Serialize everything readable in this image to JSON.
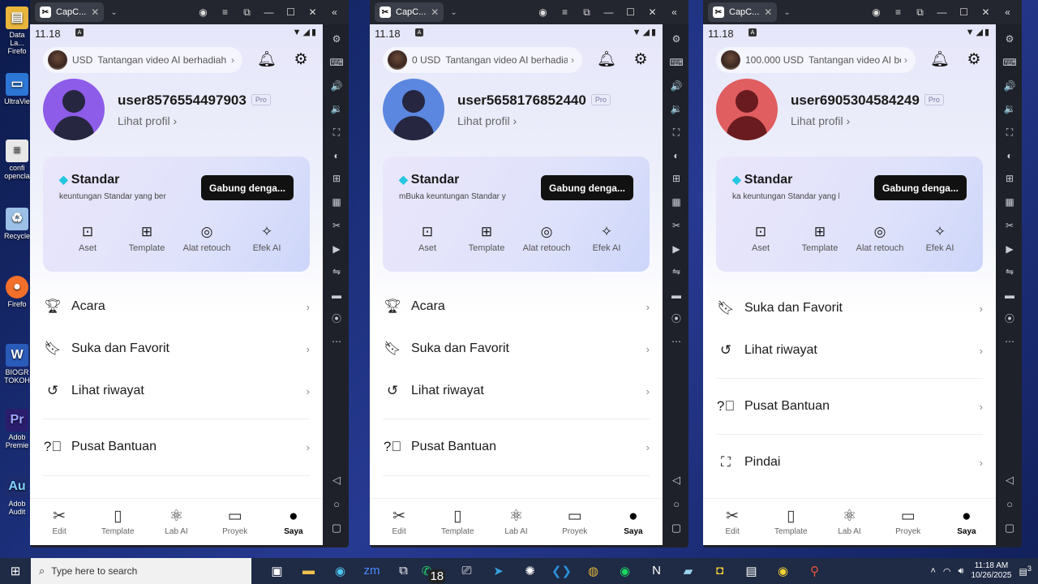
{
  "desktop": {
    "icons": [
      {
        "label": "Data La... Firefo",
        "glyph": "folder-icon",
        "color": "#e8b63c"
      },
      {
        "label": "UltraVie",
        "glyph": "ultraviewer-icon",
        "color": "#2c76d6"
      },
      {
        "label": "confi opencla",
        "glyph": "file-icon",
        "color": "#e8e8e8"
      },
      {
        "label": "Recycle",
        "glyph": "recycle-bin-icon",
        "color": "#9cc0e6"
      },
      {
        "label": "Firefo",
        "glyph": "firefox-icon",
        "color": "#f3702a"
      },
      {
        "label": "BIOGR TOKOH",
        "glyph": "word-icon",
        "color": "#2a5bb8"
      },
      {
        "label": "Adob Premie",
        "glyph": "premiere-icon",
        "color": "#2a1d6e"
      },
      {
        "label": "Adob Audit",
        "glyph": "audition-icon",
        "color": "#1d2c6e"
      }
    ]
  },
  "emulator": {
    "tab_title": "CapC...",
    "controls": [
      "user-icon",
      "menu-icon",
      "popout-icon",
      "minimize-icon",
      "maximize-icon",
      "close-icon"
    ]
  },
  "phones": [
    {
      "status_time": "11.18",
      "balance": "USD",
      "promo": "Tantangan video AI berhadiah",
      "username": "user8576554497903",
      "pro": "Pro",
      "profile_link": "Lihat profil",
      "avatar_color": "#8d5ce8",
      "std_title": "Standar",
      "std_sub": "keuntungan Standar yang bera",
      "std_btn": "Gabung denga...",
      "features": [
        "Aset",
        "Template",
        "Alat retouch",
        "Efek AI"
      ],
      "menu": [
        "Acara",
        "Suka dan Favorit",
        "Lihat riwayat",
        "Pusat Bantuan"
      ]
    },
    {
      "status_time": "11.18",
      "balance": "0 USD",
      "promo": "Tantangan video AI berhadiah",
      "username": "user5658176852440",
      "pro": "Pro",
      "profile_link": "Lihat profil",
      "avatar_color": "#5b87e0",
      "std_title": "Standar",
      "std_sub": "mBuka keuntungan Standar yang",
      "std_btn": "Gabung denga...",
      "features": [
        "Aset",
        "Template",
        "Alat retouch",
        "Efek AI"
      ],
      "menu": [
        "Acara",
        "Suka dan Favorit",
        "Lihat riwayat",
        "Pusat Bantuan"
      ]
    },
    {
      "status_time": "11.18",
      "balance": "100.000 USD",
      "promo": "Tantangan video AI berhadiah",
      "username": "user6905304584249",
      "pro": "Pro",
      "profile_link": "Lihat profil",
      "avatar_color": "#e05d60",
      "std_title": "Standar",
      "std_sub": "ka keuntungan Standar yang be",
      "std_btn": "Gabung denga...",
      "features": [
        "Aset",
        "Template",
        "Alat retouch",
        "Efek AI"
      ],
      "menu": [
        "Suka dan Favorit",
        "Lihat riwayat",
        "Pusat Bantuan",
        "Pindai"
      ]
    }
  ],
  "bottom_nav": [
    "Edit",
    "Template",
    "Lab AI",
    "Proyek",
    "Saya"
  ],
  "taskbar": {
    "search_placeholder": "Type here to search",
    "whatsapp_badge": "18",
    "time": "11:18 AM",
    "date": "10/26/2025",
    "notification_count": "3"
  }
}
